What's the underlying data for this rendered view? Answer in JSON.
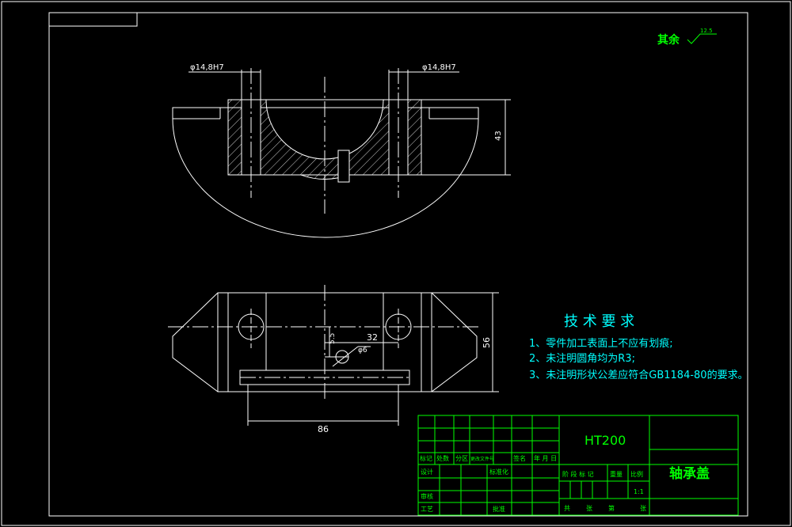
{
  "colors": {
    "background": "#000000",
    "line": "#ffffff",
    "text_green": "#00ff00",
    "text_cyan": "#00ffff",
    "text_white": "#ffffff"
  },
  "roughness_note": "其余",
  "roughness_symbol": "12.5",
  "dimensions": {
    "hole_left": "φ14,8H7",
    "hole_right": "φ14,8H7",
    "height_top": "43",
    "height_bottom": "56",
    "offset_32": "32",
    "small_hole": "φ6",
    "offset_55": "5.5",
    "width_86": "86"
  },
  "technical_requirements": {
    "title": "技 术 要 求",
    "items": [
      "1、零件加工表面上不应有划痕;",
      "2、未注明圆角均为R3;",
      "3、未注明形状公差应符合GB1184-80的要求。"
    ]
  },
  "title_block": {
    "material": "HT200",
    "part_name": "轴承盖",
    "scale_value": "1:1",
    "change_row": [
      "标记",
      "处数",
      "分区",
      "更改文件号",
      "签名",
      "年 月 日"
    ],
    "role_design": "设计",
    "role_standardize": "标准化",
    "role_review": "审核",
    "role_process": "工艺",
    "role_approve": "批准",
    "col_stage": "阶 段 标 记",
    "col_weight": "重量",
    "col_scale": "比例",
    "sheet_total": "共",
    "sheet_label": "张",
    "sheet_nth": "第",
    "sheet_label2": "张"
  }
}
